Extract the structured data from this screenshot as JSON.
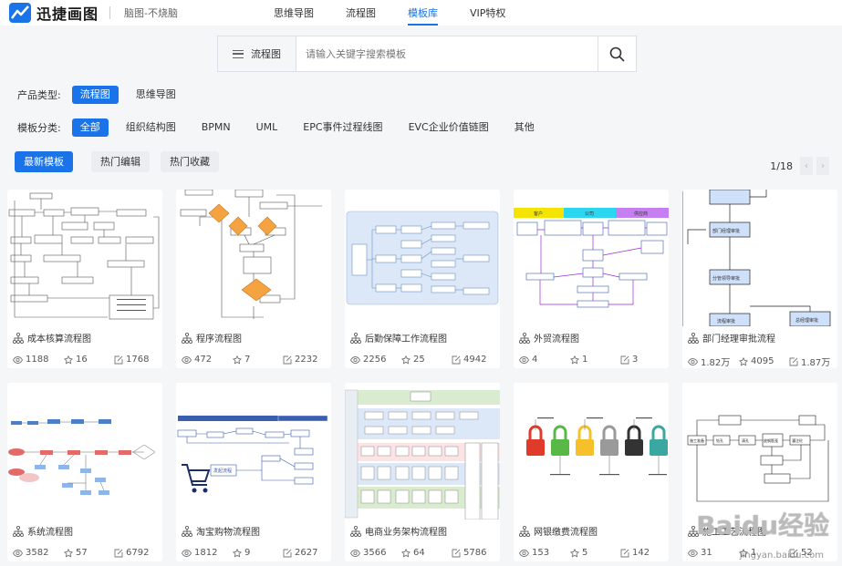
{
  "header": {
    "logo_text": "迅捷画图",
    "slogan": "脑图-不烧脑",
    "nav": [
      "思维导图",
      "流程图",
      "模板库",
      "VIP特权"
    ]
  },
  "search": {
    "category": "流程图",
    "placeholder": "请输入关键字搜索模板"
  },
  "filters": {
    "product_label": "产品类型:",
    "product_options": [
      "流程图",
      "思维导图"
    ],
    "template_label": "模板分类:",
    "template_options": [
      "全部",
      "组织结构图",
      "BPMN",
      "UML",
      "EPC事件过程线图",
      "EVC企业价值链图",
      "其他"
    ]
  },
  "sort": [
    "最新模板",
    "热门编辑",
    "热门收藏"
  ],
  "pager": {
    "text": "1/18",
    "prev": "‹",
    "next": "›"
  },
  "cards": [
    {
      "title": "成本核算流程图",
      "views": "1188",
      "likes": "16",
      "edits": "1768"
    },
    {
      "title": "程序流程图",
      "views": "472",
      "likes": "7",
      "edits": "2232"
    },
    {
      "title": "后勤保障工作流程图",
      "views": "2256",
      "likes": "25",
      "edits": "4942"
    },
    {
      "title": "外贸流程图",
      "views": "4",
      "likes": "1",
      "edits": "3"
    },
    {
      "title": "部门经理审批流程",
      "views": "1.82万",
      "likes": "4095",
      "edits": "1.87万"
    },
    {
      "title": "系统流程图",
      "views": "3582",
      "likes": "57",
      "edits": "6792"
    },
    {
      "title": "淘宝购物流程图",
      "views": "1812",
      "likes": "9",
      "edits": "2627"
    },
    {
      "title": "电商业务架构流程图",
      "views": "3566",
      "likes": "64",
      "edits": "5786"
    },
    {
      "title": "网银缴费流程图",
      "views": "153",
      "likes": "5",
      "edits": "142"
    },
    {
      "title": "施工工艺流程图",
      "views": "31",
      "likes": "1",
      "edits": "52"
    }
  ],
  "thumb_text": {
    "c4_headers": [
      "客户",
      "公司",
      "供应商"
    ],
    "c5_nodes": [
      "部门经理审批",
      "分管领导审批",
      "流程审批",
      "总经理审批"
    ],
    "c7_label": "发起流程",
    "c10_nodes": [
      "施工准备",
      "钻孔",
      "清孔",
      "放钢筋笼",
      "灌注砼"
    ]
  },
  "watermark": {
    "main": "Baidu经验",
    "sub": "jingyan.baidu.com"
  },
  "colors": {
    "accent": "#1a73e8",
    "page_bg": "#f5f6f8"
  }
}
